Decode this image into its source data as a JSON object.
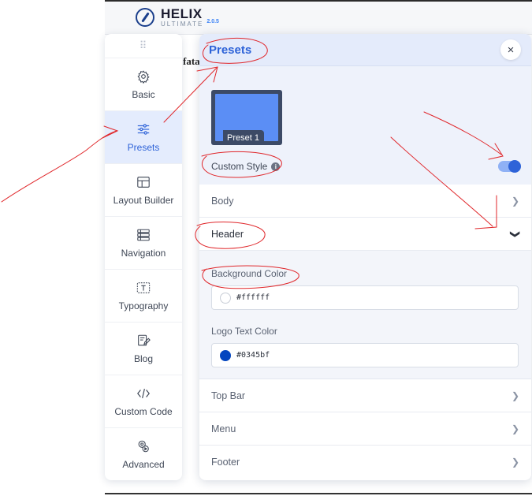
{
  "brand": {
    "title": "HELIX",
    "subtitle": "ULTIMATE",
    "version": "2.0.5"
  },
  "background_fragment": "fata",
  "sidebar": {
    "items": [
      {
        "label": "Basic",
        "icon": "gear-icon",
        "active": false
      },
      {
        "label": "Presets",
        "icon": "sliders-icon",
        "active": true
      },
      {
        "label": "Layout Builder",
        "icon": "layout-icon",
        "active": false
      },
      {
        "label": "Navigation",
        "icon": "menu-list-icon",
        "active": false
      },
      {
        "label": "Typography",
        "icon": "text-icon",
        "active": false
      },
      {
        "label": "Blog",
        "icon": "edit-icon",
        "active": false
      },
      {
        "label": "Custom Code",
        "icon": "code-icon",
        "active": false
      },
      {
        "label": "Advanced",
        "icon": "advanced-gear-icon",
        "active": false
      }
    ]
  },
  "panel": {
    "title": "Presets",
    "close_icon": "×",
    "preset_label": "Preset 1",
    "custom_style_label": "Custom Style",
    "info_icon": "i",
    "custom_style_enabled": true,
    "sections": {
      "body": "Body",
      "header": "Header",
      "top_bar": "Top Bar",
      "menu": "Menu",
      "footer": "Footer"
    },
    "header_fields": {
      "background_color_label": "Background Color",
      "background_color_value": "#ffffff",
      "logo_text_color_label": "Logo Text Color",
      "logo_text_color_value": "#0345bf"
    }
  },
  "colors": {
    "accent": "#2e63d8",
    "annotation": "#e0262a",
    "swatch_white": "#ffffff",
    "swatch_logo": "#0345bf"
  }
}
